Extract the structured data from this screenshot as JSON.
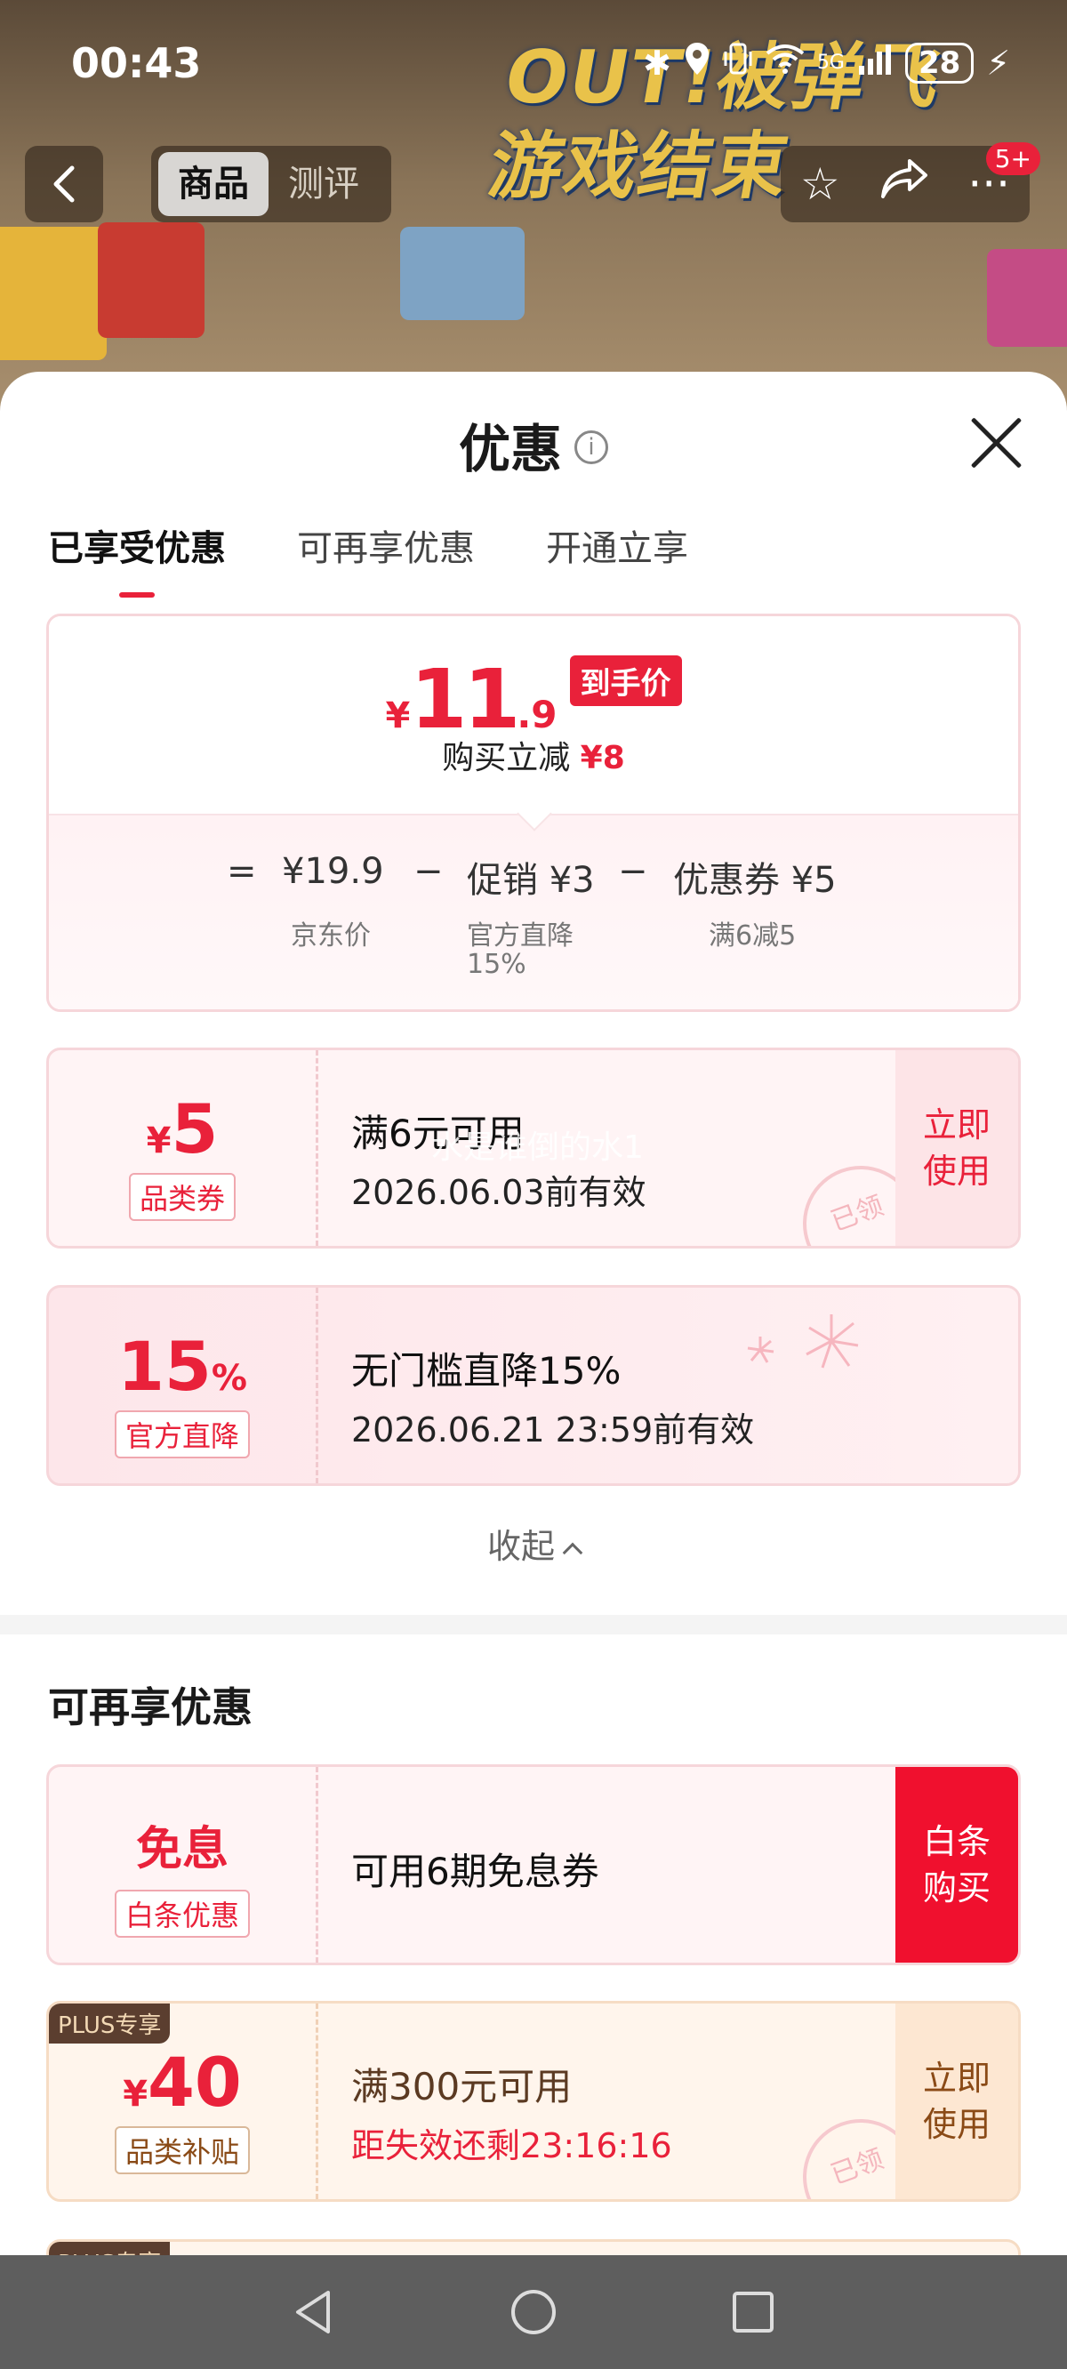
{
  "status_bar": {
    "time": "00:43",
    "battery": "28",
    "network": "5G"
  },
  "background": {
    "game_text_line1": "OUT!被弹飞",
    "game_text_line2": "游戏结束"
  },
  "top_nav": {
    "segments": [
      "商品",
      "测评"
    ],
    "badge": "5+"
  },
  "sheet": {
    "title": "优惠",
    "tabs": [
      "已享受优惠",
      "可再享优惠",
      "开通立享"
    ],
    "summary": {
      "yen": "¥",
      "price_int": "11",
      "price_dec": ".9",
      "price_tag": "到手价",
      "reduce_label": "购买立减",
      "reduce_amount": "¥8",
      "equals": "=",
      "minus": "−",
      "items": [
        {
          "value": "¥19.9",
          "label": "京东价"
        },
        {
          "value": "促销 ¥3",
          "label": "官方直降",
          "label2": "15%"
        },
        {
          "value": "优惠券 ¥5",
          "label": "满6减5"
        }
      ]
    },
    "enjoyed_coupons": [
      {
        "symbol": "¥",
        "amount": "5",
        "label": "品类券",
        "line1": "满6元可用",
        "line2": "2026.06.03前有效",
        "action": "立即使用",
        "stamp": "已领",
        "watermark": "水是谁倒的水1"
      },
      {
        "amount": "15",
        "symbol": "%",
        "label": "官方直降",
        "line1": "无门槛直降15%",
        "line2": "2026.06.21 23:59前有效"
      }
    ],
    "collapse_label": "收起",
    "more_section_title": "可再享优惠",
    "more_coupons": [
      {
        "amount": "免息",
        "label": "白条优惠",
        "line1": "可用6期免息券",
        "action": "白条购买"
      },
      {
        "tag": "PLUS专享",
        "symbol": "¥",
        "amount": "40",
        "label": "品类补贴",
        "line1": "满300元可用",
        "line2": "距失效还剩23:16:16",
        "action": "立即使用",
        "stamp": "已领"
      }
    ],
    "peek_tag": "PLUS专享"
  },
  "colors": {
    "accent": "#e9213a",
    "plus_brown": "#5b3e2f",
    "coupon_bg": "#fff4f5"
  }
}
